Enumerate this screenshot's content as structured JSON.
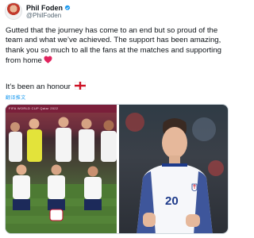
{
  "tweet": {
    "display_name": "Phil Foden",
    "handle": "@PhilFoden",
    "body": "Gutted that the journey has come to an end but so proud of the team and what we’ve achieved. The support has been amazing, thank you so much to all the fans at the matches and supporting from home",
    "closing": "It’s been an honour",
    "translate_label": "翻译推文"
  },
  "media": {
    "left_banner_text": "FIFA WORLD CUP Qatar 2022",
    "jersey_number": "20"
  },
  "colors": {
    "link_blue": "#1d9bf0",
    "heart_red": "#e0245e",
    "england_red": "#ce1124"
  },
  "icons": [
    "verified-badge-icon",
    "red-heart-emoji-icon",
    "england-flag-emoji-icon"
  ]
}
